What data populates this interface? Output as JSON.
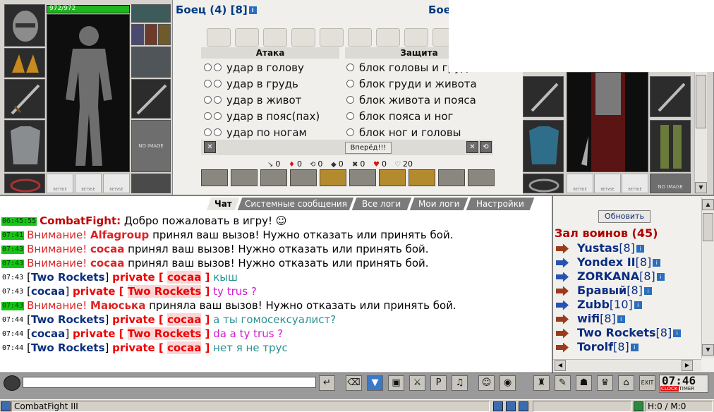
{
  "player": {
    "hp": "972/972",
    "hp_fraction": 1.0,
    "slot_no_image": "NO IMAGE"
  },
  "opponent": {
    "slot_no_image": "NO IMAGE"
  },
  "battle": {
    "title_left": "Боец (4) [8]",
    "title_right": "Бое",
    "attack_header": "Атака",
    "defense_header": "Защита",
    "attack_options": [
      "удар в голову",
      "удар в грудь",
      "удар в живот",
      "удар в пояс(пах)",
      "удар по ногам"
    ],
    "defense_options": [
      "блок головы и груди",
      "блок груди и живота",
      "блок живота и пояса",
      "блок пояса и ног",
      "блок ног и головы"
    ],
    "go_button": "Вперёд!!!",
    "stats": [
      "0",
      "0",
      "0",
      "0",
      "0",
      "0",
      "20"
    ]
  },
  "chat": {
    "tabs": [
      "Чат",
      "Системные сообщения",
      "Все логи",
      "Мои логи",
      "Настройки"
    ],
    "active_tab": 0,
    "messages": [
      {
        "time": "06:45:55",
        "time_style": "green",
        "parts": [
          [
            "sys",
            "CombatFight:"
          ],
          [
            "plain",
            " Добро пожаловать в игру! ☺"
          ]
        ]
      },
      {
        "time": "07:41",
        "time_style": "green",
        "parts": [
          [
            "warn",
            "Внимание! "
          ],
          [
            "nick",
            "Alfagroup"
          ],
          [
            "plain",
            " принял ваш вызов! Нужно отказать или принять бой."
          ]
        ]
      },
      {
        "time": "07:43",
        "time_style": "green",
        "parts": [
          [
            "warn",
            "Внимание! "
          ],
          [
            "nick",
            "cocaa"
          ],
          [
            "plain",
            " принял ваш вызов! Нужно отказать или принять бой."
          ]
        ]
      },
      {
        "time": "07:43",
        "time_style": "green",
        "parts": [
          [
            "warn",
            "Внимание! "
          ],
          [
            "nick",
            "cocaa"
          ],
          [
            "plain",
            " принял ваш вызов! Нужно отказать или принять бой."
          ]
        ]
      },
      {
        "time": "07:43",
        "time_style": "plain",
        "parts": [
          [
            "plain",
            "["
          ],
          [
            "pname",
            "Two Rockets"
          ],
          [
            "plain",
            "] "
          ],
          [
            "priv",
            "private [ "
          ],
          [
            "privname",
            "cocaa"
          ],
          [
            "priv",
            " ]"
          ],
          [
            "teal",
            " кыш"
          ]
        ]
      },
      {
        "time": "07:43",
        "time_style": "plain",
        "parts": [
          [
            "plain",
            "["
          ],
          [
            "pname",
            "cocaa"
          ],
          [
            "plain",
            "] "
          ],
          [
            "priv",
            "private [ "
          ],
          [
            "privname",
            "Two Rockets"
          ],
          [
            "priv",
            " ]"
          ],
          [
            "mag",
            " ty trus ?"
          ]
        ]
      },
      {
        "time": "07:43",
        "time_style": "green",
        "parts": [
          [
            "warn",
            "Внимание! "
          ],
          [
            "nick",
            "Маюська"
          ],
          [
            "plain",
            " приняла ваш вызов! Нужно отказать или принять бой."
          ]
        ]
      },
      {
        "time": "07:44",
        "time_style": "plain",
        "parts": [
          [
            "plain",
            "["
          ],
          [
            "pname",
            "Two Rockets"
          ],
          [
            "plain",
            "] "
          ],
          [
            "priv",
            "private [ "
          ],
          [
            "privname",
            "cocaa"
          ],
          [
            "priv",
            " ]"
          ],
          [
            "teal",
            " а ты гомосексуалист?"
          ]
        ]
      },
      {
        "time": "07:44",
        "time_style": "plain",
        "parts": [
          [
            "plain",
            "["
          ],
          [
            "pname",
            "cocaa"
          ],
          [
            "plain",
            "] "
          ],
          [
            "priv",
            "private [ "
          ],
          [
            "privname",
            "Two Rockets"
          ],
          [
            "priv",
            " ]"
          ],
          [
            "mag",
            " da a ty trus ?"
          ]
        ]
      },
      {
        "time": "07:44",
        "time_style": "plain",
        "parts": [
          [
            "plain",
            "["
          ],
          [
            "pname",
            "Two Rockets"
          ],
          [
            "plain",
            "] "
          ],
          [
            "priv",
            "private [ "
          ],
          [
            "privname",
            "cocaa"
          ],
          [
            "priv",
            " ]"
          ],
          [
            "teal",
            " нет я не трус"
          ]
        ]
      }
    ],
    "input_value": ""
  },
  "users": {
    "refresh_label": "Обновить",
    "hall_title": "Зал воинов (45)",
    "list": [
      {
        "name": "Yustas",
        "level": "[8]",
        "arrow": "red"
      },
      {
        "name": "Yondex II",
        "level": "[8]",
        "arrow": "blue"
      },
      {
        "name": "ZORKANA",
        "level": "[8]",
        "arrow": "blue"
      },
      {
        "name": "Бравый",
        "level": "[8]",
        "arrow": "red"
      },
      {
        "name": "Zubb",
        "level": "[10]",
        "arrow": "blue"
      },
      {
        "name": "wifi",
        "level": "[8]",
        "arrow": "red"
      },
      {
        "name": "Two Rockets",
        "level": "[8]",
        "arrow": "red"
      },
      {
        "name": "Torolf",
        "level": "[8]",
        "arrow": "red"
      }
    ]
  },
  "toolbar": {
    "clock": "07:46",
    "clock_label": "CLOCK",
    "timer_label": "TIMER"
  },
  "statusbar": {
    "app_title": "CombatFight III",
    "hm": "H:0 / M:0"
  },
  "colors": {
    "title_blue": "#003b80",
    "warn_red": "#d22",
    "ts_green": "#16c516"
  }
}
